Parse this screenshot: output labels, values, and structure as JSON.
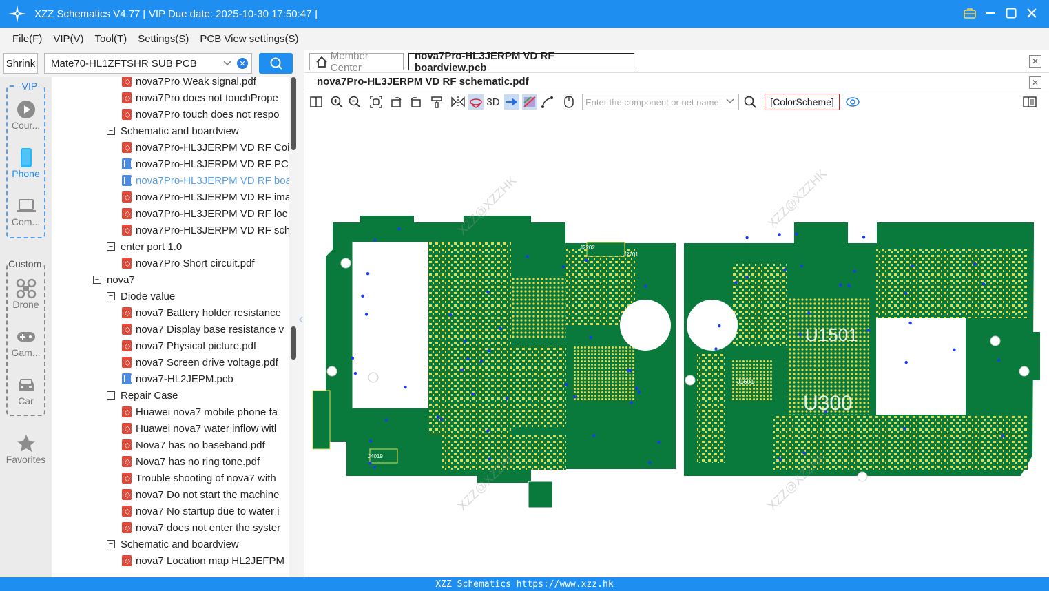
{
  "app": {
    "title": "XZZ Schematics V4.77 [ VIP Due date: 2025-10-30 17:50:47 ]",
    "status_text": "XZZ Schematics https://www.xzz.hk"
  },
  "menu": [
    "File(F)",
    "VIP(V)",
    "Tool(T)",
    "Settings(S)",
    "PCB View settings(S)"
  ],
  "search": {
    "shrink_label": "Shrink",
    "combo_value": "Mate70-HL1ZFTSHR SUB PCB"
  },
  "sidebar": {
    "vip_label": "VIP",
    "custom_label": "Custom",
    "items": [
      {
        "label": "Cour...",
        "icon": "play-icon"
      },
      {
        "label": "Phone",
        "icon": "phone-icon"
      },
      {
        "label": "Com...",
        "icon": "laptop-icon"
      },
      {
        "label": "Drone",
        "icon": "drone-icon"
      },
      {
        "label": "Gam...",
        "icon": "gamepad-icon"
      },
      {
        "label": "Car",
        "icon": "car-icon"
      },
      {
        "label": "Favorites",
        "icon": "star-icon"
      }
    ]
  },
  "tree": [
    {
      "type": "pdf",
      "label": "nova7Pro Weak signal.pdf",
      "level": 2
    },
    {
      "type": "pdf",
      "label": "nova7Pro does not touchPrope",
      "level": 2
    },
    {
      "type": "pdf",
      "label": "nova7Pro touch does not respo",
      "level": 2
    },
    {
      "type": "folder",
      "label": "Schematic and boardview",
      "level": 1
    },
    {
      "type": "pdf",
      "label": "nova7Pro-HL3JERPM VD RF Coi",
      "level": 2
    },
    {
      "type": "pcb",
      "label": "nova7Pro-HL3JERPM VD RF PCI",
      "level": 2
    },
    {
      "type": "pcb",
      "label": "nova7Pro-HL3JERPM VD RF boa",
      "level": 2,
      "selected": true
    },
    {
      "type": "pdf",
      "label": "nova7Pro-HL3JERPM VD RF ima",
      "level": 2
    },
    {
      "type": "pdf",
      "label": "nova7Pro-HL3JERPM VD RF loc",
      "level": 2
    },
    {
      "type": "pdf",
      "label": "nova7Pro-HL3JERPM VD RF sch",
      "level": 2
    },
    {
      "type": "folder",
      "label": "enter port 1.0",
      "level": 1
    },
    {
      "type": "pdf",
      "label": "nova7Pro Short circuit.pdf",
      "level": 2
    },
    {
      "type": "folder",
      "label": "nova7",
      "level": 0
    },
    {
      "type": "folder",
      "label": "Diode value",
      "level": 1
    },
    {
      "type": "pdf",
      "label": "nova7 Battery holder resistance",
      "level": 2
    },
    {
      "type": "pdf",
      "label": "nova7 Display base resistance v",
      "level": 2
    },
    {
      "type": "pdf",
      "label": "nova7 Physical picture.pdf",
      "level": 2
    },
    {
      "type": "pdf",
      "label": "nova7 Screen drive voltage.pdf",
      "level": 2
    },
    {
      "type": "pcb",
      "label": "nova7-HL2JEPM.pcb",
      "level": 2
    },
    {
      "type": "folder",
      "label": "Repair Case",
      "level": 1
    },
    {
      "type": "pdf",
      "label": "Huawei nova7 mobile phone fa",
      "level": 2
    },
    {
      "type": "pdf",
      "label": "Huawei nova7 water inflow witl",
      "level": 2
    },
    {
      "type": "pdf",
      "label": "Nova7 has no baseband.pdf",
      "level": 2
    },
    {
      "type": "pdf",
      "label": "Nova7 has no ring tone.pdf",
      "level": 2
    },
    {
      "type": "pdf",
      "label": "Trouble shooting of nova7 with",
      "level": 2
    },
    {
      "type": "pdf",
      "label": "nova7 Do not start the machine",
      "level": 2
    },
    {
      "type": "pdf",
      "label": "nova7 No startup due to water i",
      "level": 2
    },
    {
      "type": "pdf",
      "label": "nova7 does not enter the syster",
      "level": 2
    },
    {
      "type": "folder",
      "label": "Schematic and boardview",
      "level": 1
    },
    {
      "type": "pdf",
      "label": "nova7 Location map HL2JEFPM",
      "level": 2
    }
  ],
  "tabs": {
    "member_center": "Member Center",
    "active_tab": "nova7Pro-HL3JERPM VD RF boardview.pcb",
    "secondary_tab": "nova7Pro-HL3JERPM VD RF schematic.pdf"
  },
  "toolbar": {
    "three_d_label": "3D",
    "net_placeholder": "Enter the component or net name",
    "color_scheme_label": "[ColorScheme]"
  },
  "board": {
    "labels": [
      "U1501",
      "U300",
      "J2202",
      "J2701",
      "J4019",
      "J1601"
    ],
    "watermark": "XZZ@XZZHK",
    "colors": {
      "board": "#0a7a3c",
      "pad": "#e8d84a",
      "via": "#1a3cf0",
      "outline": "#ffffff"
    }
  }
}
